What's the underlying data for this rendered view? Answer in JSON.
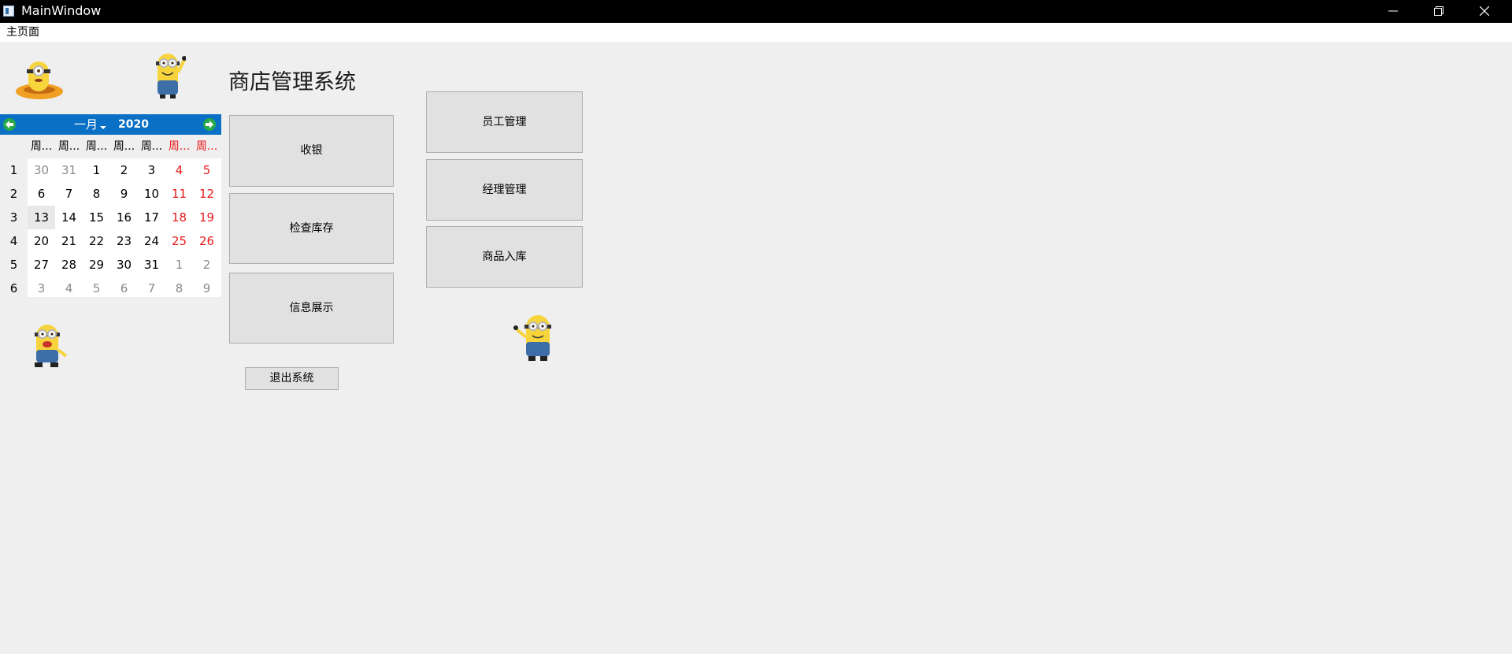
{
  "window": {
    "title": "MainWindow",
    "icons": {
      "minimize": "minimize-icon",
      "maximize": "restore-icon",
      "close": "close-icon"
    }
  },
  "menu": {
    "items": [
      "主页面"
    ]
  },
  "app_title": "商店管理系统",
  "calendar": {
    "month": "一月",
    "year": "2020",
    "weekday_headers": [
      "周...",
      "周...",
      "周...",
      "周...",
      "周...",
      "周...",
      "周..."
    ],
    "week_numbers": [
      "1",
      "2",
      "3",
      "4",
      "5",
      "6"
    ],
    "weeks": [
      [
        "30",
        "31",
        "1",
        "2",
        "3",
        "4",
        "5"
      ],
      [
        "6",
        "7",
        "8",
        "9",
        "10",
        "11",
        "12"
      ],
      [
        "13",
        "14",
        "15",
        "16",
        "17",
        "18",
        "19"
      ],
      [
        "20",
        "21",
        "22",
        "23",
        "24",
        "25",
        "26"
      ],
      [
        "27",
        "28",
        "29",
        "30",
        "31",
        "1",
        "2"
      ],
      [
        "3",
        "4",
        "5",
        "6",
        "7",
        "8",
        "9"
      ]
    ],
    "selected_date": "13",
    "colors": {
      "header": "#0a70c6",
      "weekend": "#e8181a",
      "other_month": "#8a8a8a",
      "nav": "#27a94a"
    }
  },
  "buttons": {
    "cashier": "收银",
    "check_stock": "检查库存",
    "info_display": "信息展示",
    "staff_mgmt": "员工管理",
    "manager_mgmt": "经理管理",
    "goods_in": "商品入库",
    "exit": "退出系统"
  }
}
